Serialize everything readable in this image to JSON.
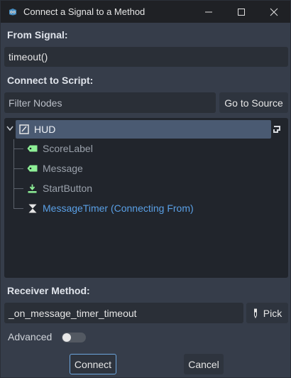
{
  "window": {
    "title": "Connect a Signal to a Method"
  },
  "from_signal": {
    "label": "From Signal:",
    "value": "timeout()"
  },
  "connect_to_script": {
    "label": "Connect to Script:",
    "filter_placeholder": "Filter Nodes",
    "goto_source_label": "Go to Source"
  },
  "tree": {
    "root": {
      "label": "HUD",
      "icon": "control-icon"
    },
    "children": [
      {
        "label": "ScoreLabel",
        "icon": "label-icon"
      },
      {
        "label": "Message",
        "icon": "label-icon"
      },
      {
        "label": "StartButton",
        "icon": "button-icon"
      },
      {
        "label": "MessageTimer (Connecting From)",
        "icon": "timer-icon"
      }
    ]
  },
  "receiver": {
    "label": "Receiver Method:",
    "value": "_on_message_timer_timeout",
    "pick_label": "Pick"
  },
  "advanced": {
    "label": "Advanced",
    "enabled": false
  },
  "buttons": {
    "connect": "Connect",
    "cancel": "Cancel"
  },
  "colors": {
    "accent": "#5aa0e6",
    "label_icon": "#8eef97",
    "selected_row": "#4a5a72",
    "background": "#363d4a"
  }
}
